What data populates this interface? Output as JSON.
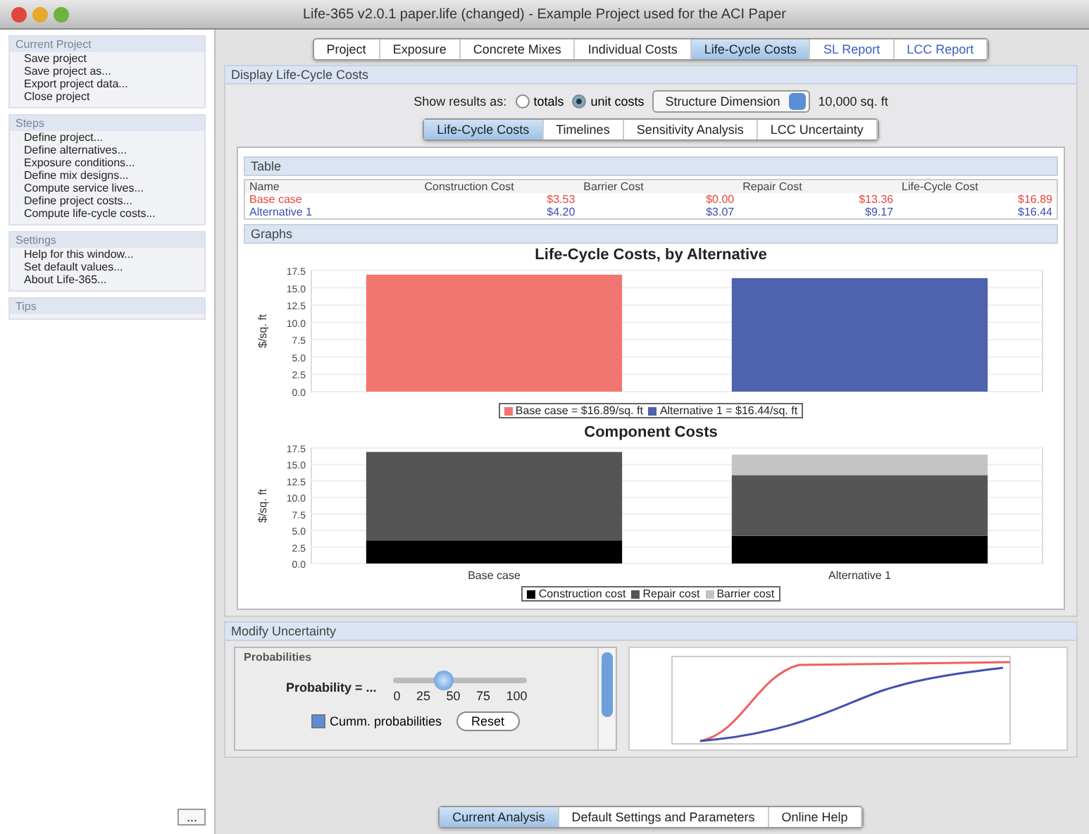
{
  "window": {
    "title": "Life-365 v2.0.1 paper.life (changed) - Example Project used for the ACI Paper"
  },
  "sidebar": {
    "sections": [
      {
        "title": "Current Project",
        "items": [
          "Save project",
          "Save project as...",
          "Export project data...",
          "Close project"
        ]
      },
      {
        "title": "Steps",
        "items": [
          "Define project...",
          "Define alternatives...",
          "Exposure conditions...",
          "Define mix designs...",
          "Compute service lives...",
          "Define project costs...",
          "Compute life-cycle costs..."
        ]
      },
      {
        "title": "Settings",
        "items": [
          "Help for this window...",
          "Set default values...",
          "About Life-365..."
        ]
      },
      {
        "title": "Tips"
      }
    ],
    "more_button": "..."
  },
  "tabs": [
    {
      "label": "Project",
      "selected": false,
      "kind": "page"
    },
    {
      "label": "Exposure",
      "selected": false,
      "kind": "page"
    },
    {
      "label": "Concrete Mixes",
      "selected": false,
      "kind": "page"
    },
    {
      "label": "Individual Costs",
      "selected": false,
      "kind": "page"
    },
    {
      "label": "Life-Cycle Costs",
      "selected": true,
      "kind": "page"
    },
    {
      "label": "SL Report",
      "selected": false,
      "kind": "report"
    },
    {
      "label": "LCC Report",
      "selected": false,
      "kind": "report"
    }
  ],
  "display": {
    "title": "Display Life-Cycle Costs",
    "show_label": "Show results as:",
    "options": [
      {
        "label": "totals",
        "selected": false
      },
      {
        "label": "unit costs",
        "selected": true
      }
    ],
    "dimension": "Structure Dimension",
    "dimension_value": "10,000 sq. ft"
  },
  "subtabs": [
    {
      "label": "Life-Cycle Costs",
      "selected": true
    },
    {
      "label": "Timelines",
      "selected": false
    },
    {
      "label": "Sensitivity Analysis",
      "selected": false
    },
    {
      "label": "LCC Uncertainty",
      "selected": false
    }
  ],
  "table": {
    "title": "Table",
    "columns": [
      "Name",
      "Construction Cost",
      "Barrier Cost",
      "Repair Cost",
      "Life-Cycle Cost"
    ],
    "rows": [
      {
        "color": "#e8443a",
        "cells": [
          "Base case",
          "$3.53",
          "$0.00",
          "$13.36",
          "$16.89"
        ]
      },
      {
        "color": "#3a4fb0",
        "cells": [
          "Alternative 1",
          "$4.20",
          "$3.07",
          "$9.17",
          "$16.44"
        ]
      }
    ]
  },
  "graphs": {
    "title": "Graphs",
    "charts": [
      {
        "chart_data": {
          "type": "bar",
          "title": "Life-Cycle Costs, by Alternative",
          "ylabel": "$/sq. ft",
          "categories": [
            null,
            null
          ],
          "stacked": true,
          "grid": true,
          "legend": "bottom",
          "ylim": [
            0,
            17.5
          ],
          "yticks": [
            {
              "value": 0,
              "label": "0.0"
            },
            {
              "value": 2.5,
              "label": "2.5"
            },
            {
              "value": 5,
              "label": "5.0"
            },
            {
              "value": 7.5,
              "label": "7.5"
            },
            {
              "value": 10,
              "label": "10.0"
            },
            {
              "value": 12.5,
              "label": "12.5"
            },
            {
              "value": 15,
              "label": "15.0"
            },
            {
              "value": 17.5,
              "label": "17.5"
            }
          ],
          "series": [
            {
              "name": "Base case = $16.89/sq. ft",
              "color": "#f27670",
              "values": [
                16.9,
                null
              ]
            },
            {
              "name": "Alternative 1 = $16.44/sq. ft",
              "color": "#4f62ad",
              "values": [
                null,
                16.4
              ]
            }
          ]
        }
      },
      {
        "chart_data": {
          "type": "bar",
          "title": "Component Costs",
          "ylabel": "$/sq. ft",
          "categories": [
            "Base case",
            "Alternative 1"
          ],
          "stacked": true,
          "grid": true,
          "legend": "bottom",
          "ylim": [
            0,
            17.5
          ],
          "yticks": [
            {
              "value": 0,
              "label": "0.0"
            },
            {
              "value": 2.5,
              "label": "2.5"
            },
            {
              "value": 5,
              "label": "5.0"
            },
            {
              "value": 7.5,
              "label": "7.5"
            },
            {
              "value": 10,
              "label": "10.0"
            },
            {
              "value": 12.5,
              "label": "12.5"
            },
            {
              "value": 15,
              "label": "15.0"
            },
            {
              "value": 17.5,
              "label": "17.5"
            }
          ],
          "series": [
            {
              "name": "Construction cost",
              "color": "#000000",
              "values": [
                3.5,
                4.2
              ]
            },
            {
              "name": "Repair cost",
              "color": "#555555",
              "values": [
                13.4,
                9.2
              ]
            },
            {
              "name": "Barrier cost",
              "color": "#c4c4c4",
              "values": [
                0,
                3.1
              ]
            }
          ]
        }
      }
    ]
  },
  "uncertainty": {
    "title": "Modify Uncertainty",
    "group": "Probabilities",
    "probability_label": "Probability = ...",
    "slider": {
      "level": 0.38,
      "ticks": [
        "0",
        "25",
        "50",
        "75",
        "100"
      ]
    },
    "cumulative": {
      "label": "Cumm. probabilities",
      "checked": true
    },
    "reset": "Reset"
  },
  "bottom_tabs": [
    {
      "label": "Current Analysis",
      "selected": true
    },
    {
      "label": "Default Settings and Parameters",
      "selected": false
    },
    {
      "label": "Online Help",
      "selected": false
    }
  ]
}
